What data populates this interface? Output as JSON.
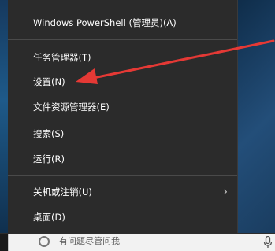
{
  "menu": {
    "items": [
      {
        "label": "Windows PowerShell (管理员)(A)"
      },
      {
        "label": "任务管理器(T)"
      },
      {
        "label": "设置(N)"
      },
      {
        "label": "文件资源管理器(E)"
      },
      {
        "label": "搜索(S)"
      },
      {
        "label": "运行(R)"
      },
      {
        "label": "关机或注销(U)",
        "submenu_indicator": "›"
      },
      {
        "label": "桌面(D)"
      }
    ]
  },
  "taskbar": {
    "search_placeholder": "有问题尽管问我"
  },
  "icons": {
    "search": "search-icon",
    "microphone": "microphone-icon",
    "submenu": "chevron-right-icon"
  },
  "colors": {
    "menu_background": "#2b2b2b",
    "menu_text": "#ffffff",
    "annotation_arrow": "#e53935"
  }
}
